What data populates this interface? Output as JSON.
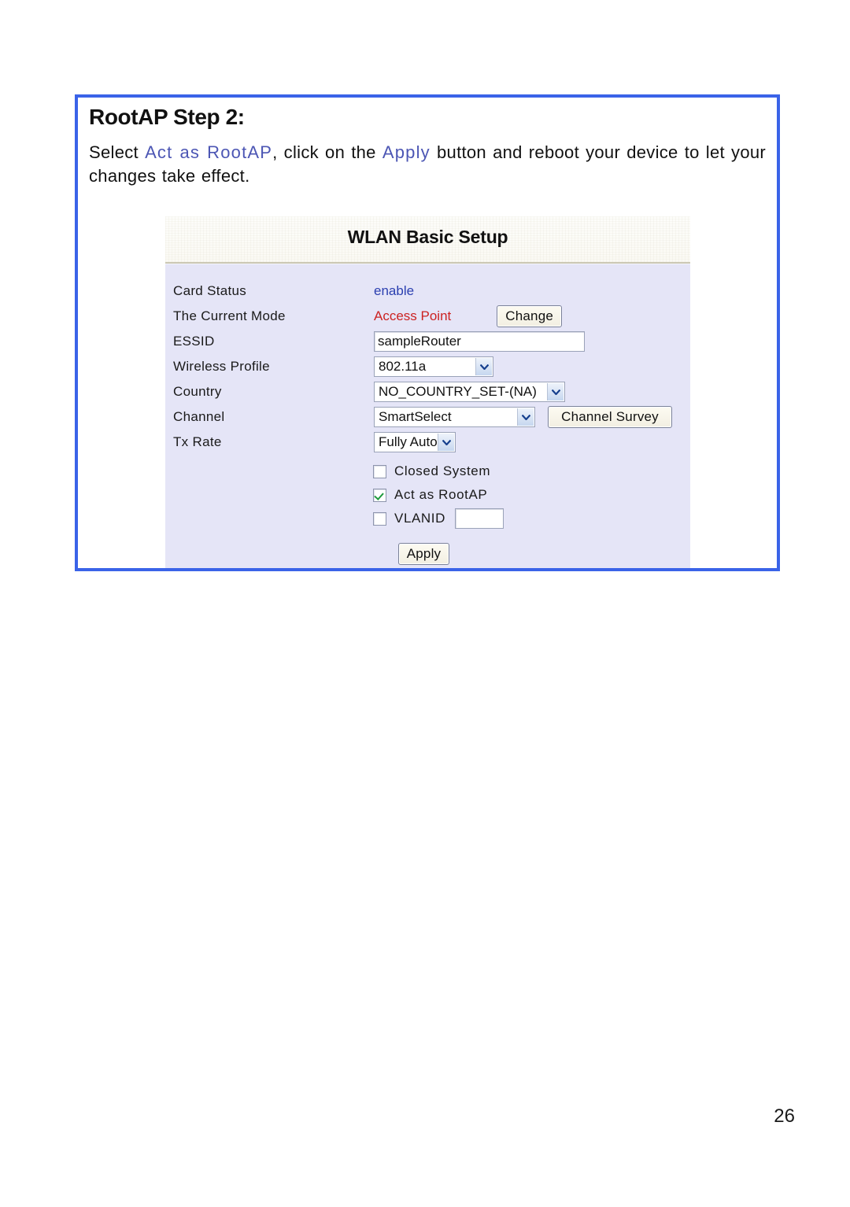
{
  "document": {
    "page_number": "26",
    "accent_color": "#3a63e8",
    "highlight_color": "#4c56b4"
  },
  "instructions": {
    "step_heading": "RootAP Step 2:",
    "sentence": {
      "part1": "Select ",
      "highlight1": "Act as RootAP",
      "part2": ", click on the ",
      "highlight2": "Apply",
      "part3": " button and reboot your device to let your changes take effect."
    }
  },
  "wlan_panel": {
    "title": "WLAN Basic Setup",
    "rows": {
      "card_status": {
        "label": "Card Status",
        "value": "enable",
        "value_color": "#2b3fb0"
      },
      "current_mode": {
        "label": "The Current Mode",
        "value": "Access Point",
        "value_color": "#cc2222",
        "button_label": "Change"
      },
      "essid": {
        "label": "ESSID",
        "value": "sampleRouter",
        "placeholder": ""
      },
      "wireless_profile": {
        "label": "Wireless Profile",
        "value": "802.11a"
      },
      "country": {
        "label": "Country",
        "value": "NO_COUNTRY_SET-(NA)"
      },
      "channel": {
        "label": "Channel",
        "value": "SmartSelect",
        "button_label": "Channel Survey"
      },
      "tx_rate": {
        "label": "Tx Rate",
        "value": "Fully Auto"
      }
    },
    "checkboxes": [
      {
        "label": "Closed System",
        "checked": false
      },
      {
        "label": "Act as RootAP",
        "checked": true
      },
      {
        "label": "VLANID",
        "checked": false,
        "field_value": ""
      }
    ],
    "apply_button": "Apply"
  }
}
